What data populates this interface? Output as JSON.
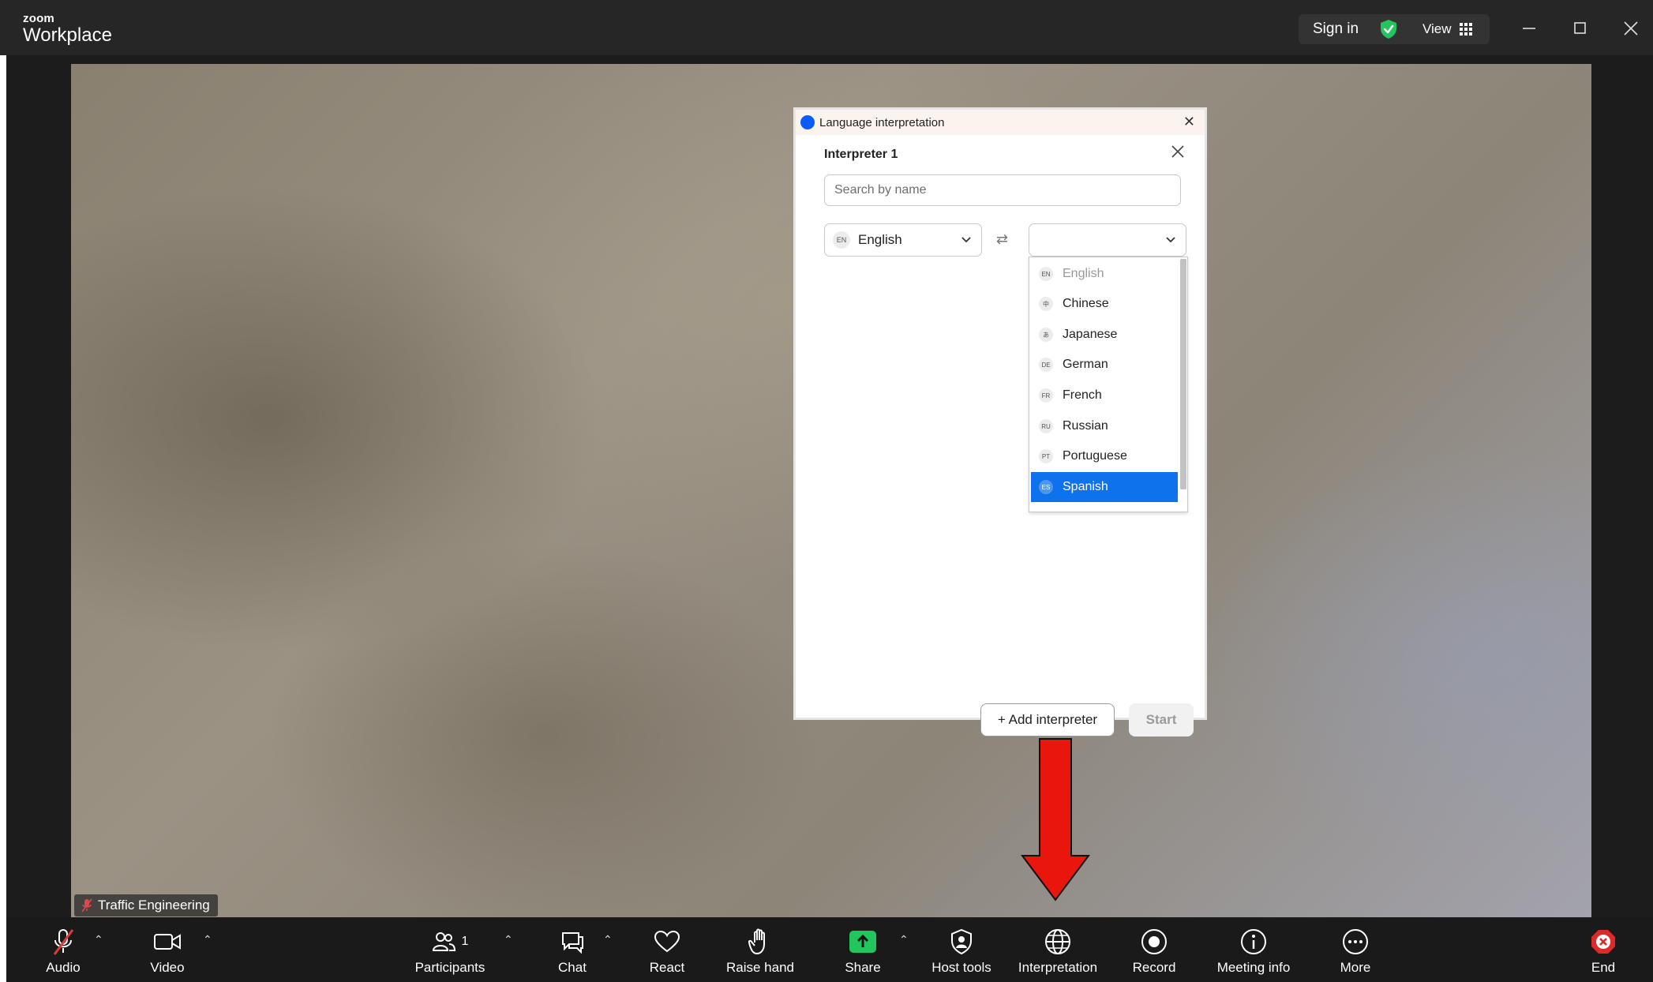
{
  "titlebar": {
    "brand_small": "zoom",
    "brand_big": "Workplace",
    "signin": "Sign in",
    "view": "View"
  },
  "video": {
    "participant_name": "Traffic Engineering"
  },
  "dialog": {
    "window_title": "Language interpretation",
    "interpreter_title": "Interpreter 1",
    "search_placeholder": "Search by name",
    "source_language": {
      "code": "EN",
      "name": "English"
    },
    "target_language": {
      "code": "",
      "name": ""
    },
    "options": [
      {
        "code": "EN",
        "name": "English",
        "state": "disabled"
      },
      {
        "code": "中",
        "name": "Chinese",
        "state": "normal"
      },
      {
        "code": "あ",
        "name": "Japanese",
        "state": "normal"
      },
      {
        "code": "DE",
        "name": "German",
        "state": "normal"
      },
      {
        "code": "FR",
        "name": "French",
        "state": "normal"
      },
      {
        "code": "RU",
        "name": "Russian",
        "state": "normal"
      },
      {
        "code": "PT",
        "name": "Portuguese",
        "state": "normal"
      },
      {
        "code": "ES",
        "name": "Spanish",
        "state": "selected"
      }
    ],
    "add_interpreter": "+ Add interpreter",
    "start": "Start"
  },
  "toolbar": {
    "audio": "Audio",
    "video": "Video",
    "participants": "Participants",
    "participants_count": "1",
    "chat": "Chat",
    "react": "React",
    "raise_hand": "Raise hand",
    "share": "Share",
    "host_tools": "Host tools",
    "interpretation": "Interpretation",
    "record": "Record",
    "meeting_info": "Meeting info",
    "more": "More",
    "end": "End"
  },
  "colors": {
    "accent": "#0e72ed",
    "share_green": "#22c55e",
    "end_red": "#e02828",
    "arrow_red": "#e8160c",
    "shield_green": "#22c55e"
  }
}
